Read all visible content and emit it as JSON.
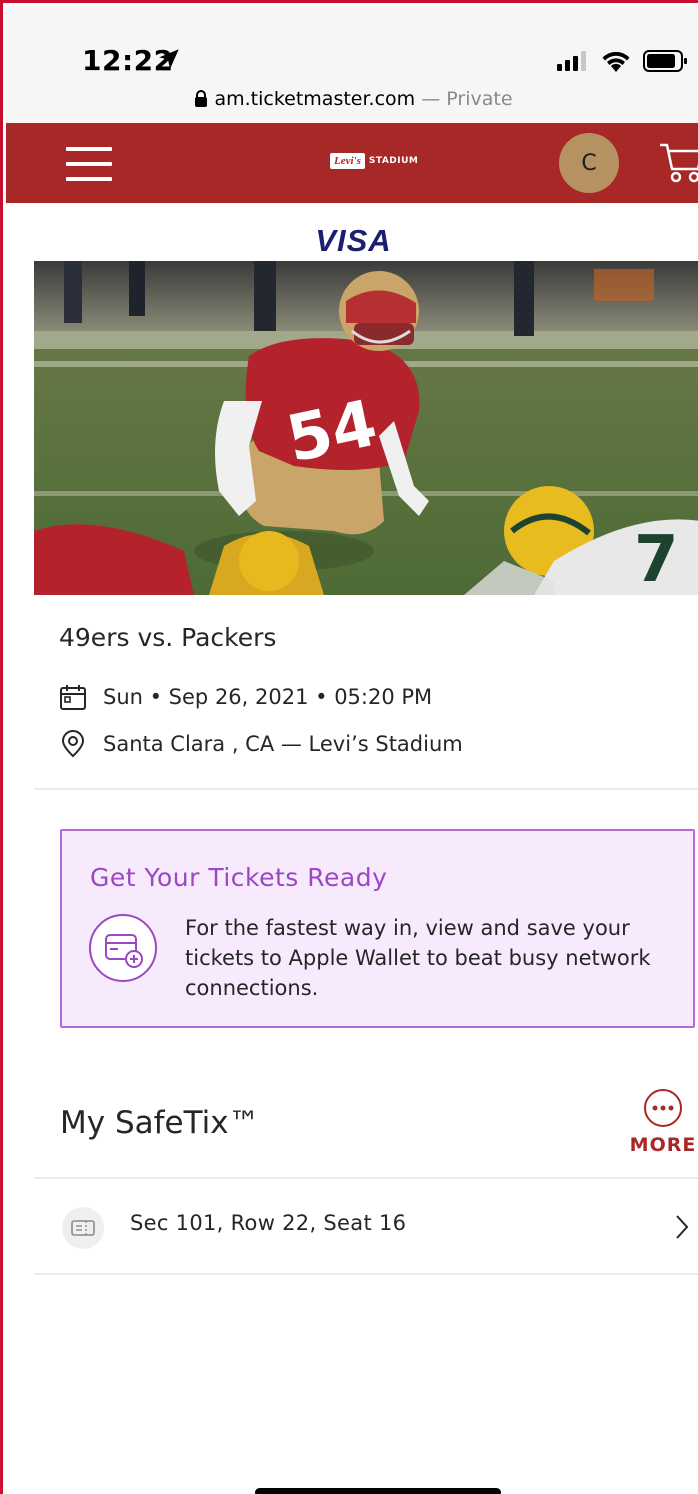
{
  "status_bar": {
    "time": "12:22"
  },
  "browser": {
    "domain": "am.ticketmaster.com",
    "mode": "— Private"
  },
  "header": {
    "logo_brand": "Levi's",
    "logo_venue": "STADIUM",
    "avatar_initial": "C",
    "color": "#a82828"
  },
  "sponsor": {
    "name": "VISA"
  },
  "event": {
    "title": "49ers vs. Packers",
    "datetime": "Sun • Sep 26, 2021 • 05:20 PM",
    "location": "Santa Clara , CA — Levi’s Stadium"
  },
  "promo": {
    "title": "Get Your Tickets Ready",
    "body": "For the fastest way in, view and save your tickets to Apple Wallet to beat busy network connections.",
    "accent": "#9a48c4"
  },
  "safetix": {
    "title": "My SafeTix™",
    "more_label": "MORE",
    "tickets": [
      {
        "label": "Sec 101, Row 22, Seat 16"
      }
    ]
  },
  "icons": [
    "location-arrow-icon",
    "signal-icon",
    "wifi-icon",
    "battery-icon",
    "lock-icon",
    "hamburger-icon",
    "cart-icon",
    "calendar-icon",
    "map-pin-icon",
    "wallet-add-icon",
    "more-dots-icon",
    "ticket-icon",
    "chevron-right-icon"
  ]
}
